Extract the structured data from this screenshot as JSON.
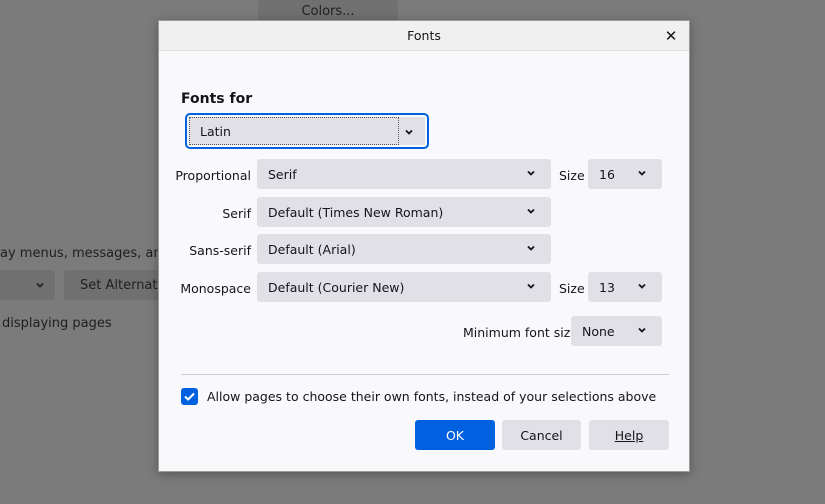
{
  "background": {
    "colors_button": "Colors...",
    "menus_text": "ay menus, messages, and r",
    "set_alternative_button": "Set Alternati",
    "displaying_text": "displaying pages"
  },
  "dialog": {
    "title": "Fonts",
    "fonts_for_label": "Fonts for",
    "language_select": "Latin",
    "rows": [
      {
        "label": "Proportional",
        "value": "Serif",
        "size_label": "Size",
        "size_value": "16"
      },
      {
        "label": "Serif",
        "value": "Default (Times New Roman)"
      },
      {
        "label": "Sans-serif",
        "value": "Default (Arial)"
      },
      {
        "label": "Monospace",
        "value": "Default (Courier New)",
        "size_label": "Size",
        "size_value": "13"
      }
    ],
    "min_font_size_label": "Minimum font size",
    "min_font_size_value": "None",
    "allow_pages_checkbox": {
      "label": "Allow pages to choose their own fonts, instead of your selections above",
      "checked": true
    },
    "buttons": {
      "ok": "OK",
      "cancel": "Cancel",
      "help": "Help"
    }
  },
  "colors": {
    "accent": "#0061e0",
    "dialog_bg": "#f9f9fb",
    "select_bg": "#e0e0e6",
    "overlay": "#7b7b7b"
  }
}
